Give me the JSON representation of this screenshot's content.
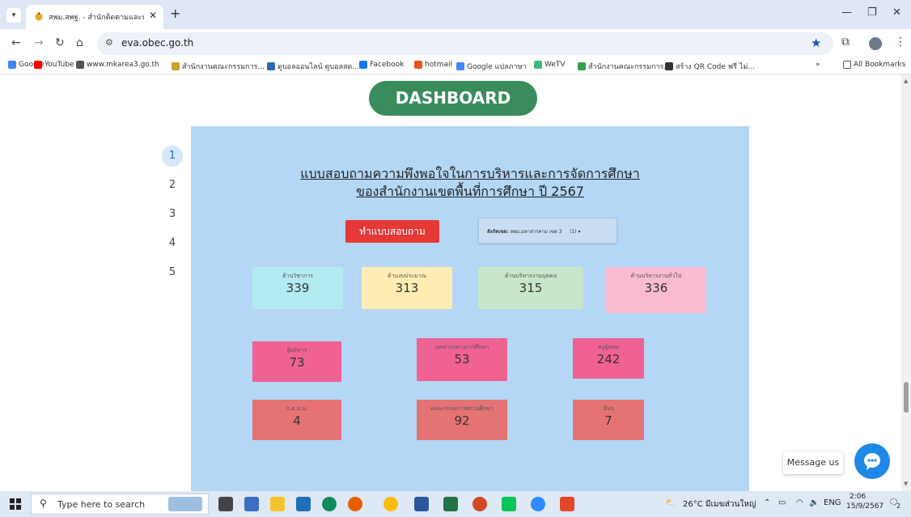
{
  "browser": {
    "tab_title": "สพม.สพฐ. - สำนักติดตามและประเมิน",
    "url": "eva.obec.go.th",
    "bookmarks": [
      {
        "label": "Google",
        "color": "#4285f4"
      },
      {
        "label": "YouTube",
        "color": "#ff0000"
      },
      {
        "label": "www.mkarea3.go.th",
        "color": "#555555"
      },
      {
        "label": "สำนักงานคณะกรรมการ...",
        "color": "#c9a227"
      },
      {
        "label": "ดูบอลออนไลน์ ดูบอลสด...",
        "color": "#2b6cb0"
      },
      {
        "label": "Facebook",
        "color": "#1877f2"
      },
      {
        "label": "hotmail",
        "color": "#f25022"
      },
      {
        "label": "Google แปลภาษา",
        "color": "#4285f4"
      },
      {
        "label": "WeTV",
        "color": "#41b883"
      },
      {
        "label": "สำนักงานคณะกรรมการ...",
        "color": "#2ea44f"
      },
      {
        "label": "สร้าง QR Code ฟรี ไม่...",
        "color": "#333333"
      }
    ],
    "all_bookmarks": "All Bookmarks",
    "overflow": "»"
  },
  "page": {
    "dashboard_label": "DASHBOARD",
    "steps": [
      "1",
      "2",
      "3",
      "4",
      "5"
    ],
    "survey_title_line1": "แบบสอบถามความพึงพอใจในการบริหารและการจัดการศึกษา",
    "survey_title_line2": "ของสำนักงานเขตพื้นที่การศึกษา ปี 2567",
    "do_survey_button": "ทำแบบสอบถาม",
    "area_select": {
      "label": "สังกัดเขต:",
      "value": "สพม.มหาสารคาม เขต 3",
      "count": "(1)"
    },
    "cards_row1": [
      {
        "label": "ด้านวิชาการ",
        "value": "339",
        "color": "#b2ebf2"
      },
      {
        "label": "ด้านงบประมาณ",
        "value": "313",
        "color": "#ffecb3"
      },
      {
        "label": "ด้านบริหารงานบุคคล",
        "value": "315",
        "color": "#c8e6c9"
      },
      {
        "label": "ด้านบริหารงานทั่วไป",
        "value": "336",
        "color": "#f8bbd0"
      }
    ],
    "cards_row2": [
      {
        "label": "ผู้บริหาร",
        "value": "73",
        "color": "#f06292"
      },
      {
        "label": "บุคลากรทางการศึกษา",
        "value": "53",
        "color": "#f06292"
      },
      {
        "label": "ครูผู้สอน",
        "value": "242",
        "color": "#f06292"
      }
    ],
    "cards_row3": [
      {
        "label": "ก.ต.ป.น.",
        "value": "4",
        "color": "#e57373"
      },
      {
        "label": "คณะกรรมการสถานศึกษา",
        "value": "92",
        "color": "#e57373"
      },
      {
        "label": "อื่นๆ",
        "value": "7",
        "color": "#e57373"
      }
    ],
    "message_us": "Message us"
  },
  "taskbar": {
    "search_placeholder": "Type here to search",
    "weather": "26°C มีเมฆส่วนใหญ่",
    "lang": "ENG",
    "time": "2:06",
    "date": "15/9/2567",
    "notif_count": "2"
  }
}
